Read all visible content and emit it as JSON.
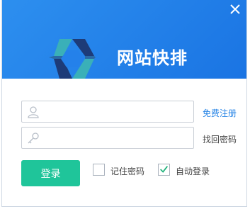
{
  "header": {
    "app_title": "网站快排",
    "background_color": "#1f7fe9",
    "close_icon": "close-icon",
    "logo_icon": "hexagon-logo-icon"
  },
  "login_form": {
    "username": {
      "value": "",
      "placeholder": "",
      "icon": "user-icon"
    },
    "password": {
      "value": "",
      "placeholder": "",
      "icon": "key-icon"
    },
    "register_link": "免费注册",
    "recover_link": "找回密码",
    "login_button": "登录",
    "login_button_color": "#1fc59a",
    "remember_password": {
      "label": "记住密码",
      "checked": false
    },
    "auto_login": {
      "label": "自动登录",
      "checked": true
    }
  }
}
